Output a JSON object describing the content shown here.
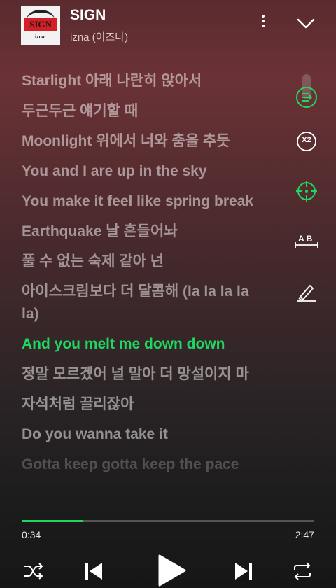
{
  "track": {
    "title": "SIGN",
    "artist": "izna (이즈나)",
    "album_art_text": "SIGN",
    "album_art_small_text": "izna"
  },
  "lyrics": [
    {
      "text": "Starlight 아래 나란히 앉아서",
      "state": "past"
    },
    {
      "text": "두근두근 얘기할 때",
      "state": "past"
    },
    {
      "text": "Moonlight 위에서 너와 춤을 추듯",
      "state": "past"
    },
    {
      "text": "You and I are up in the sky",
      "state": "past"
    },
    {
      "text": "You make it feel like spring break",
      "state": "past"
    },
    {
      "text": "Earthquake 날 흔들어놔",
      "state": "past"
    },
    {
      "text": "풀 수 없는 숙제 같아 넌",
      "state": "past"
    },
    {
      "text": "아이스크림보다 더 달콤해 (la la la la la)",
      "state": "past"
    },
    {
      "text": "And you melt me down down",
      "state": "active"
    },
    {
      "text": "정말 모르겠어 널 말아 더 망설이지 마",
      "state": "upcoming"
    },
    {
      "text": "자석처럼 끌리잖아",
      "state": "upcoming"
    },
    {
      "text": "Do you wanna take it",
      "state": "upcoming"
    },
    {
      "text": "Gotta keep gotta keep the pace",
      "state": "fade"
    }
  ],
  "tools": {
    "speed_label": "X2",
    "ab_label": "AB"
  },
  "playback": {
    "current_time": "0:34",
    "total_time": "2:47",
    "progress": 0.21
  },
  "colors": {
    "accent": "#1ed760",
    "background_top": "#6b3236",
    "background_bottom": "#161616"
  },
  "icons": [
    "more-vertical-icon",
    "chevron-down-icon",
    "lyrics-sync-icon",
    "speed-icon",
    "crosshair-icon",
    "ab-repeat-icon",
    "highlight-pen-icon",
    "shuffle-icon",
    "previous-icon",
    "play-icon",
    "next-icon",
    "repeat-icon"
  ]
}
